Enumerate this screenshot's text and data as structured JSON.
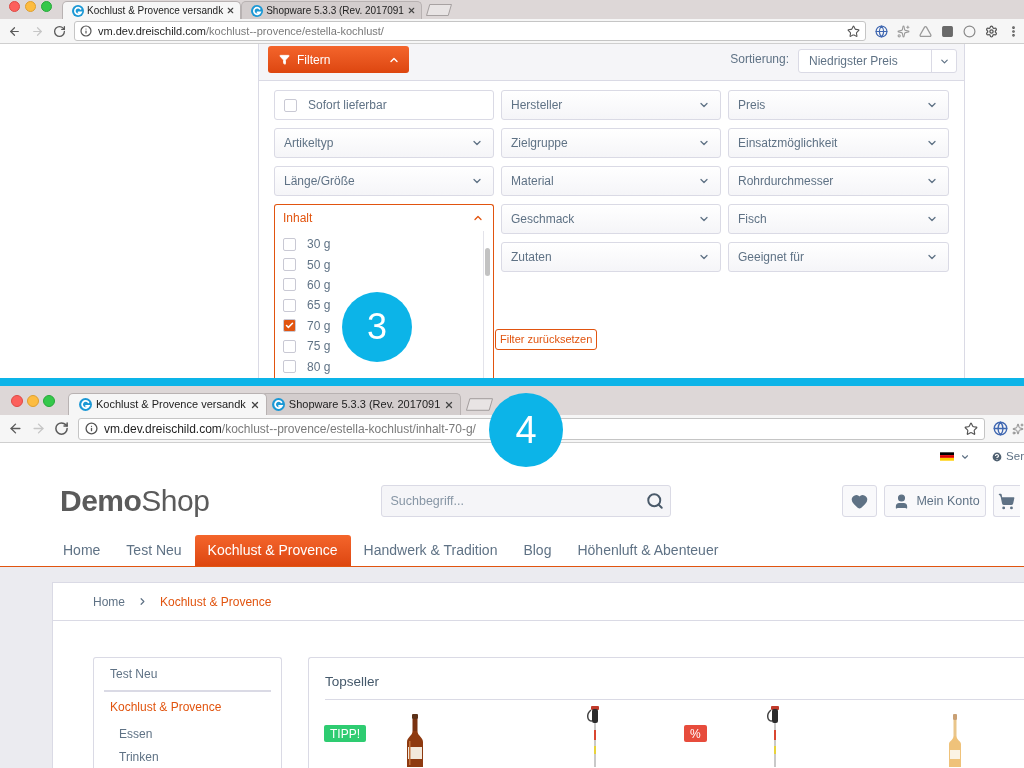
{
  "top_capture": {
    "browser": {
      "tabs": [
        {
          "title": "Kochlust & Provence versandk",
          "selected": true
        },
        {
          "title": "Shopware 5.3.3 (Rev. 2017091",
          "selected": false
        }
      ],
      "forward_disabled": true,
      "url": {
        "domain": "vm.dev.dreischild.com",
        "path": "/kochlust--provence/estella-kochlust/"
      }
    },
    "filter_bar": {
      "button": "Filtern",
      "expanded": true,
      "sort_label": "Sortierung:",
      "sort_value": "Niedrigster Preis"
    },
    "filters": [
      {
        "kind": "checkbox",
        "label": "Sofort lieferbar",
        "checked": false
      },
      {
        "kind": "dropdown",
        "label": "Hersteller",
        "expanded": false
      },
      {
        "kind": "dropdown",
        "label": "Preis",
        "expanded": false
      },
      {
        "kind": "dropdown",
        "label": "Artikeltyp",
        "expanded": false
      },
      {
        "kind": "dropdown",
        "label": "Zielgruppe",
        "expanded": false
      },
      {
        "kind": "dropdown",
        "label": "Einsatzmöglichkeit",
        "expanded": false
      },
      {
        "kind": "dropdown",
        "label": "Länge/Größe",
        "expanded": false
      },
      {
        "kind": "dropdown",
        "label": "Material",
        "expanded": false
      },
      {
        "kind": "dropdown",
        "label": "Rohrdurchmesser",
        "expanded": false
      },
      {
        "kind": "dropdown",
        "label": "Inhalt",
        "expanded": true,
        "options": [
          {
            "label": "30 g",
            "checked": false
          },
          {
            "label": "50 g",
            "checked": false
          },
          {
            "label": "60 g",
            "checked": false
          },
          {
            "label": "65 g",
            "checked": false
          },
          {
            "label": "70 g",
            "checked": true
          },
          {
            "label": "75 g",
            "checked": false
          },
          {
            "label": "80 g",
            "checked": false
          }
        ]
      },
      {
        "kind": "dropdown",
        "label": "Geschmack",
        "expanded": false
      },
      {
        "kind": "dropdown",
        "label": "Fisch",
        "expanded": false
      },
      {
        "kind": "dropdown",
        "label": "Zutaten",
        "expanded": false
      },
      {
        "kind": "dropdown",
        "label": "Geeignet für",
        "expanded": false
      }
    ],
    "reset_button": "Filter zurücksetzen",
    "step_badge": "3"
  },
  "bottom_capture": {
    "browser": {
      "tabs": [
        {
          "title": "Kochlust & Provence versandk",
          "selected": true
        },
        {
          "title": "Shopware 5.3.3 (Rev. 2017091",
          "selected": false
        }
      ],
      "forward_disabled": true,
      "url": {
        "domain": "vm.dev.dreischild.com",
        "path": "/kochlust--provence/estella-kochlust/inhalt-70-g/"
      }
    },
    "step_badge": "4",
    "service_link": "Ser",
    "logo": "**Demo**Shop",
    "search": {
      "placeholder": "Suchbegriff..."
    },
    "account_button": "Mein Konto",
    "nav": [
      {
        "label": "Home",
        "selected": false
      },
      {
        "label": "Test Neu",
        "selected": false
      },
      {
        "label": "Kochlust & Provence",
        "selected": true
      },
      {
        "label": "Handwerk & Tradition",
        "selected": false
      },
      {
        "label": "Blog",
        "selected": false
      },
      {
        "label": "Höhenluft & Abenteuer",
        "selected": false
      }
    ],
    "breadcrumb": [
      {
        "label": "Home",
        "current": false
      },
      {
        "label": "Kochlust & Provence",
        "current": true
      }
    ],
    "sidebar": [
      {
        "label": "Test Neu",
        "selected": false
      },
      {
        "label": "Kochlust & Provence",
        "selected": true,
        "children": [
          {
            "label": "Essen",
            "selected": false
          },
          {
            "label": "Trinken",
            "selected": false
          }
        ]
      }
    ],
    "topseller": {
      "title": "Topseller",
      "products": [
        {
          "kind": "bottle",
          "badge": {
            "text": "TIPP!",
            "color": "#2ecc71"
          }
        },
        {
          "kind": "pole"
        },
        {
          "kind": "pole",
          "badge": {
            "text": "%",
            "color": "#e74c3c"
          }
        },
        {
          "kind": "flask"
        }
      ]
    }
  }
}
